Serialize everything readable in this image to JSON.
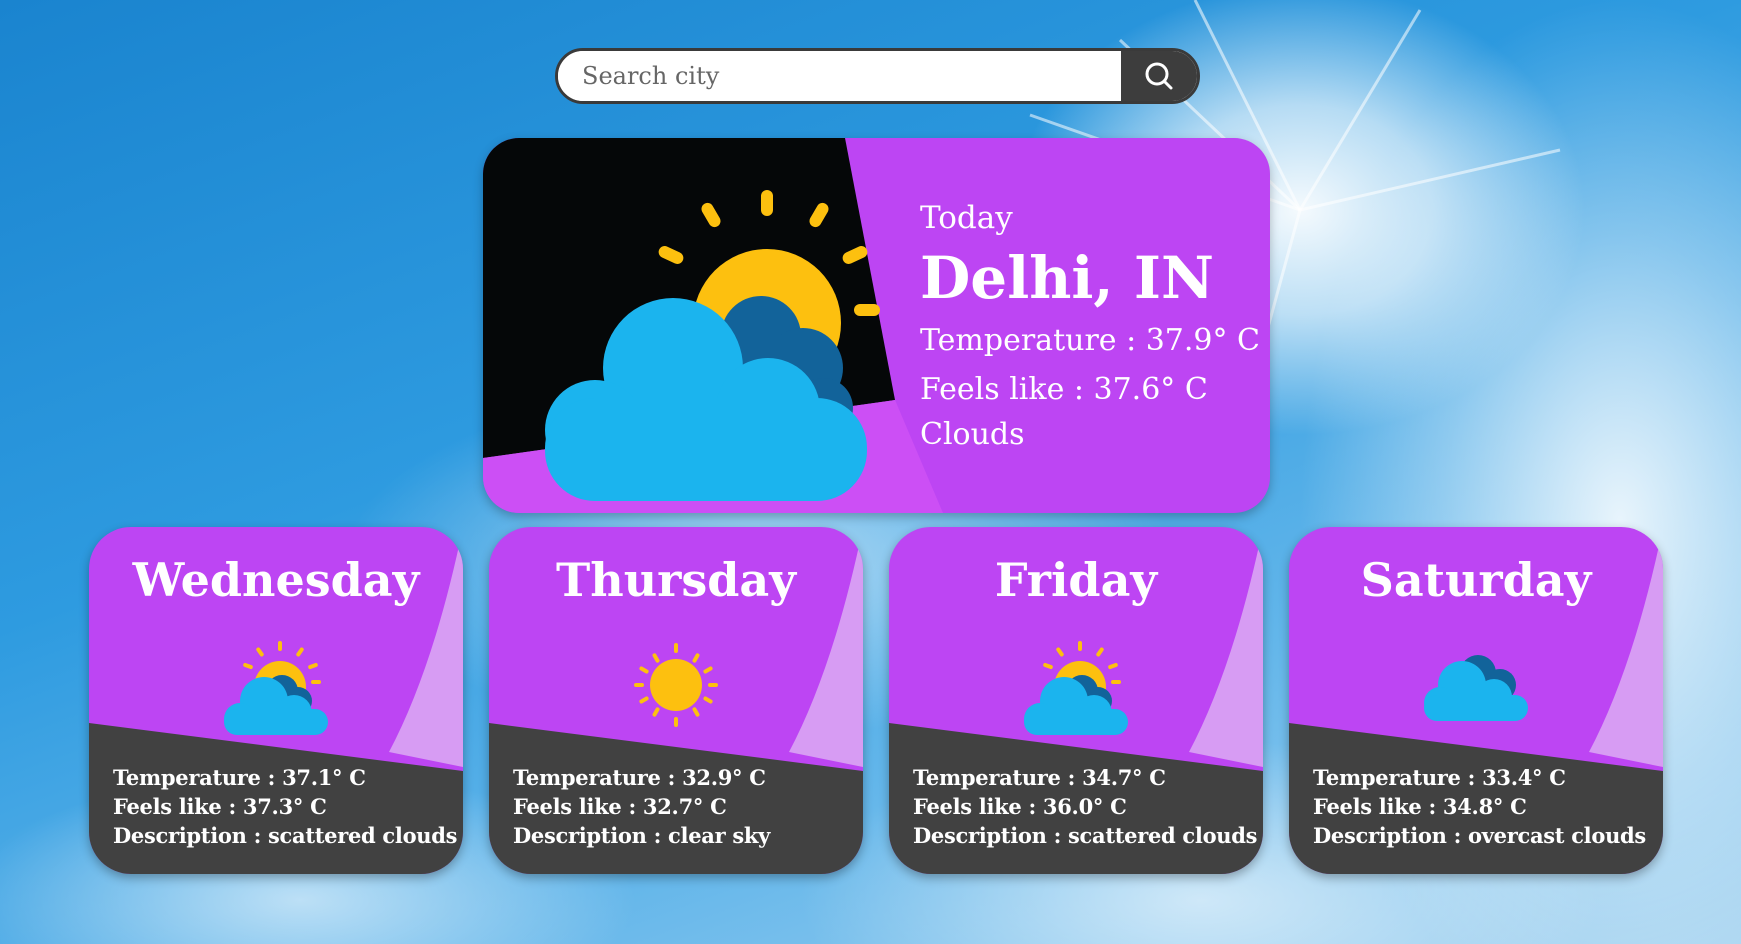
{
  "search": {
    "placeholder": "Search city",
    "icon": "search-icon"
  },
  "today": {
    "label": "Today",
    "city": "Delhi, IN",
    "temperature": "Temperature : 37.9° C",
    "feels_like": "Feels like : 37.6° C",
    "description": "Clouds",
    "icon": "partly-cloudy-icon"
  },
  "forecast": [
    {
      "day": "Wednesday",
      "temperature": "Temperature : 37.1° C",
      "feels_like": "Feels like : 37.3° C",
      "description": "Description : scattered clouds",
      "icon": "scattered-clouds-icon"
    },
    {
      "day": "Thursday",
      "temperature": "Temperature : 32.9° C",
      "feels_like": "Feels like : 32.7° C",
      "description": "Description : clear sky",
      "icon": "sun-icon"
    },
    {
      "day": "Friday",
      "temperature": "Temperature : 34.7° C",
      "feels_like": "Feels like : 36.0° C",
      "description": "Description : scattered clouds",
      "icon": "scattered-clouds-icon"
    },
    {
      "day": "Saturday",
      "temperature": "Temperature : 33.4° C",
      "feels_like": "Feels like : 34.8° C",
      "description": "Description : overcast clouds",
      "icon": "overcast-clouds-icon"
    }
  ],
  "colors": {
    "card_purple": "#bd45f3",
    "card_light_purple": "#d79cf3",
    "card_dark": "#414141",
    "sun": "#fdc00f",
    "cloud_light": "#1bb4ee",
    "cloud_dark": "#12639a"
  }
}
